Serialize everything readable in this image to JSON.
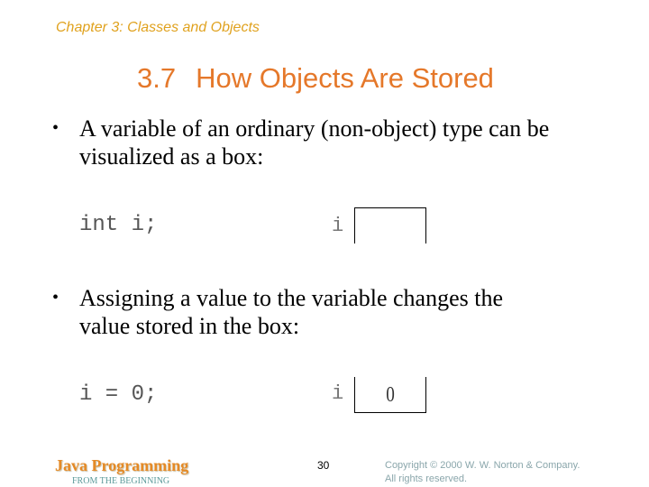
{
  "header": {
    "chapter": "Chapter 3: Classes and Objects",
    "section_number": "3.7",
    "section_title": "How Objects Are Stored"
  },
  "bullets": [
    {
      "symbol": "•",
      "lines": [
        "A variable of an ordinary (non-object) type can be",
        "visualized as a box:"
      ]
    },
    {
      "symbol": "•",
      "lines": [
        "Assigning a value to the variable changes the",
        "value stored in the box:"
      ]
    }
  ],
  "examples": [
    {
      "code": "int i;",
      "var_label": "i",
      "box_value": ""
    },
    {
      "code": "i = 0;",
      "var_label": "i",
      "box_value": "0"
    }
  ],
  "footer": {
    "brand": "Java Programming",
    "subtitle": "FROM THE BEGINNING",
    "page_number": "30",
    "copyright_line1": "Copyright © 2000 W. W. Norton & Company.",
    "copyright_line2": "All rights reserved."
  },
  "colors": {
    "chapter": "#e0a21f",
    "title": "#e5782a",
    "brand": "#e58a26",
    "subtitle": "#5c9a9a",
    "copyright": "#8aa6ab"
  }
}
